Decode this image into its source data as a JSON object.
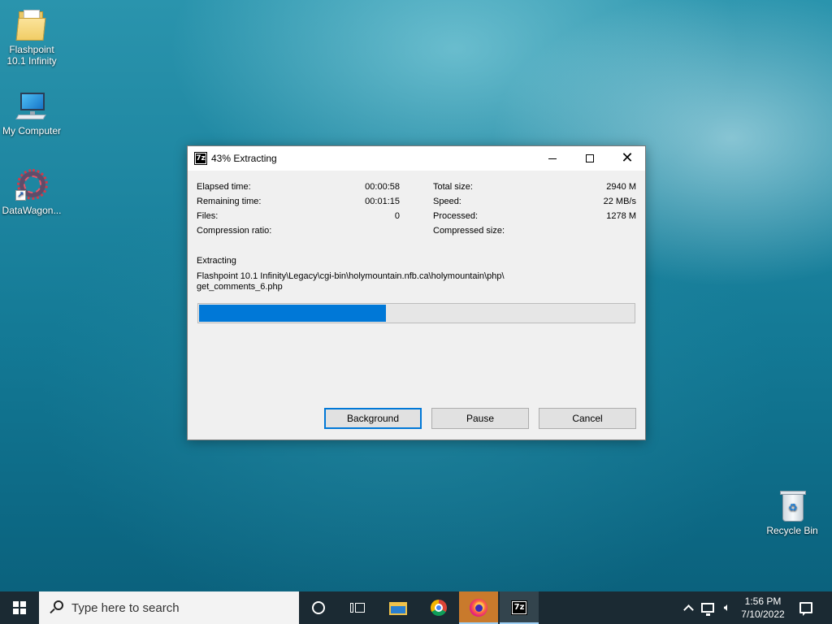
{
  "desktop": {
    "icons": [
      {
        "label": "Flashpoint 10.1 Infinity"
      },
      {
        "label": "My Computer"
      },
      {
        "label": "DataWagon..."
      },
      {
        "label": "Recycle Bin"
      }
    ]
  },
  "dialog": {
    "app_icon_text": "7z",
    "title": "43% Extracting",
    "stats_left": [
      {
        "label": "Elapsed time:",
        "value": "00:00:58"
      },
      {
        "label": "Remaining time:",
        "value": "00:01:15"
      },
      {
        "label": "Files:",
        "value": "0"
      },
      {
        "label": "Compression ratio:",
        "value": ""
      }
    ],
    "stats_right": [
      {
        "label": "Total size:",
        "value": "2940 M"
      },
      {
        "label": "Speed:",
        "value": "22 MB/s"
      },
      {
        "label": "Processed:",
        "value": "1278 M"
      },
      {
        "label": "Compressed size:",
        "value": ""
      }
    ],
    "operation_label": "Extracting",
    "current_file_line1": "Flashpoint 10.1 Infinity\\Legacy\\cgi-bin\\holymountain.nfb.ca\\holymountain\\php\\",
    "current_file_line2": "get_comments_6.php",
    "progress_percent": 43,
    "buttons": {
      "background": "Background",
      "pause": "Pause",
      "cancel": "Cancel"
    }
  },
  "taskbar": {
    "search_placeholder": "Type here to search",
    "apps": [
      "cortana-icon",
      "task-view-icon",
      "file-explorer-icon",
      "chrome-icon",
      "firefox-icon",
      "7zip-icon"
    ],
    "sevenzip_label": "7z",
    "clock_time": "1:56 PM",
    "clock_date": "7/10/2022"
  },
  "colors": {
    "accent": "#0078d7",
    "taskbar": "#1b2a33"
  }
}
